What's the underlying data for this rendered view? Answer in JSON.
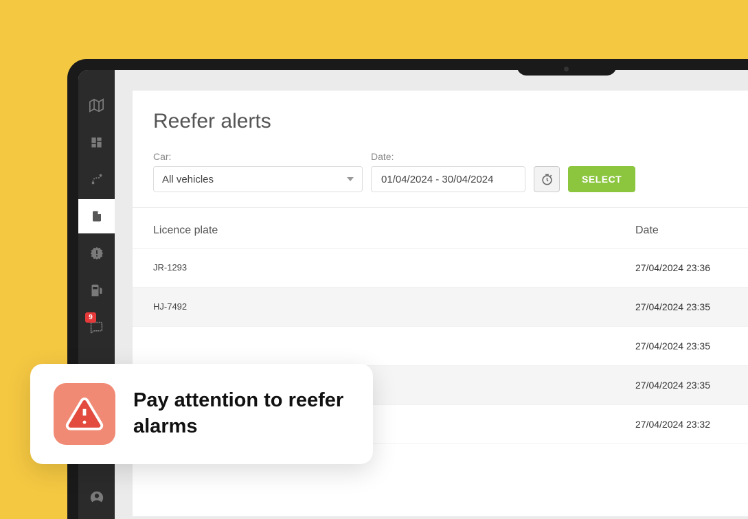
{
  "page": {
    "title": "Reefer alerts"
  },
  "sidebar": {
    "badge_count": "9"
  },
  "filters": {
    "car_label": "Car:",
    "car_value": "All vehicles",
    "date_label": "Date:",
    "date_value": "01/04/2024 - 30/04/2024",
    "select_label": "SELECT"
  },
  "table": {
    "headers": {
      "plate": "Licence plate",
      "date": "Date"
    },
    "rows": [
      {
        "plate": "JR-1293",
        "date": "27/04/2024 23:36"
      },
      {
        "plate": "HJ-7492",
        "date": "27/04/2024 23:35"
      },
      {
        "plate": "",
        "date": "27/04/2024 23:35"
      },
      {
        "plate": "",
        "date": "27/04/2024 23:35"
      },
      {
        "plate": "",
        "date": "27/04/2024 23:32"
      }
    ]
  },
  "callout": {
    "text": "Pay attention to reefer alarms"
  }
}
